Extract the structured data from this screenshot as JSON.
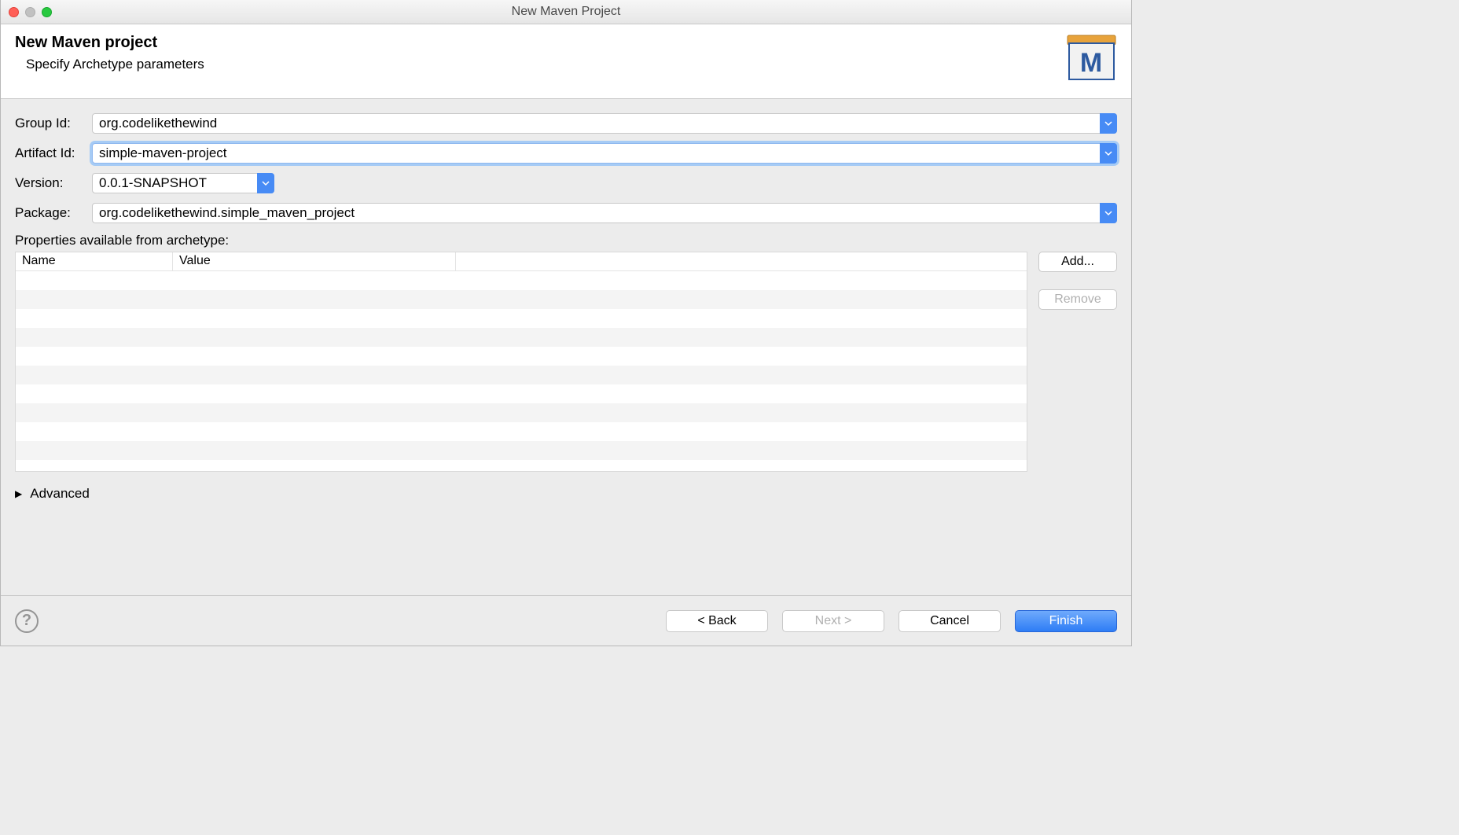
{
  "window": {
    "title": "New Maven Project"
  },
  "header": {
    "title": "New Maven project",
    "subtitle": "Specify Archetype parameters"
  },
  "form": {
    "groupId": {
      "label": "Group Id:",
      "value": "org.codelikethewind"
    },
    "artifactId": {
      "label": "Artifact Id:",
      "value": "simple-maven-project"
    },
    "version": {
      "label": "Version:",
      "value": "0.0.1-SNAPSHOT"
    },
    "package": {
      "label": "Package:",
      "value": "org.codelikethewind.simple_maven_project"
    }
  },
  "properties": {
    "label": "Properties available from archetype:",
    "columns": {
      "name": "Name",
      "value": "Value"
    },
    "buttons": {
      "add": "Add...",
      "remove": "Remove"
    }
  },
  "advanced": {
    "label": "Advanced"
  },
  "footer": {
    "back": "< Back",
    "next": "Next >",
    "cancel": "Cancel",
    "finish": "Finish"
  }
}
